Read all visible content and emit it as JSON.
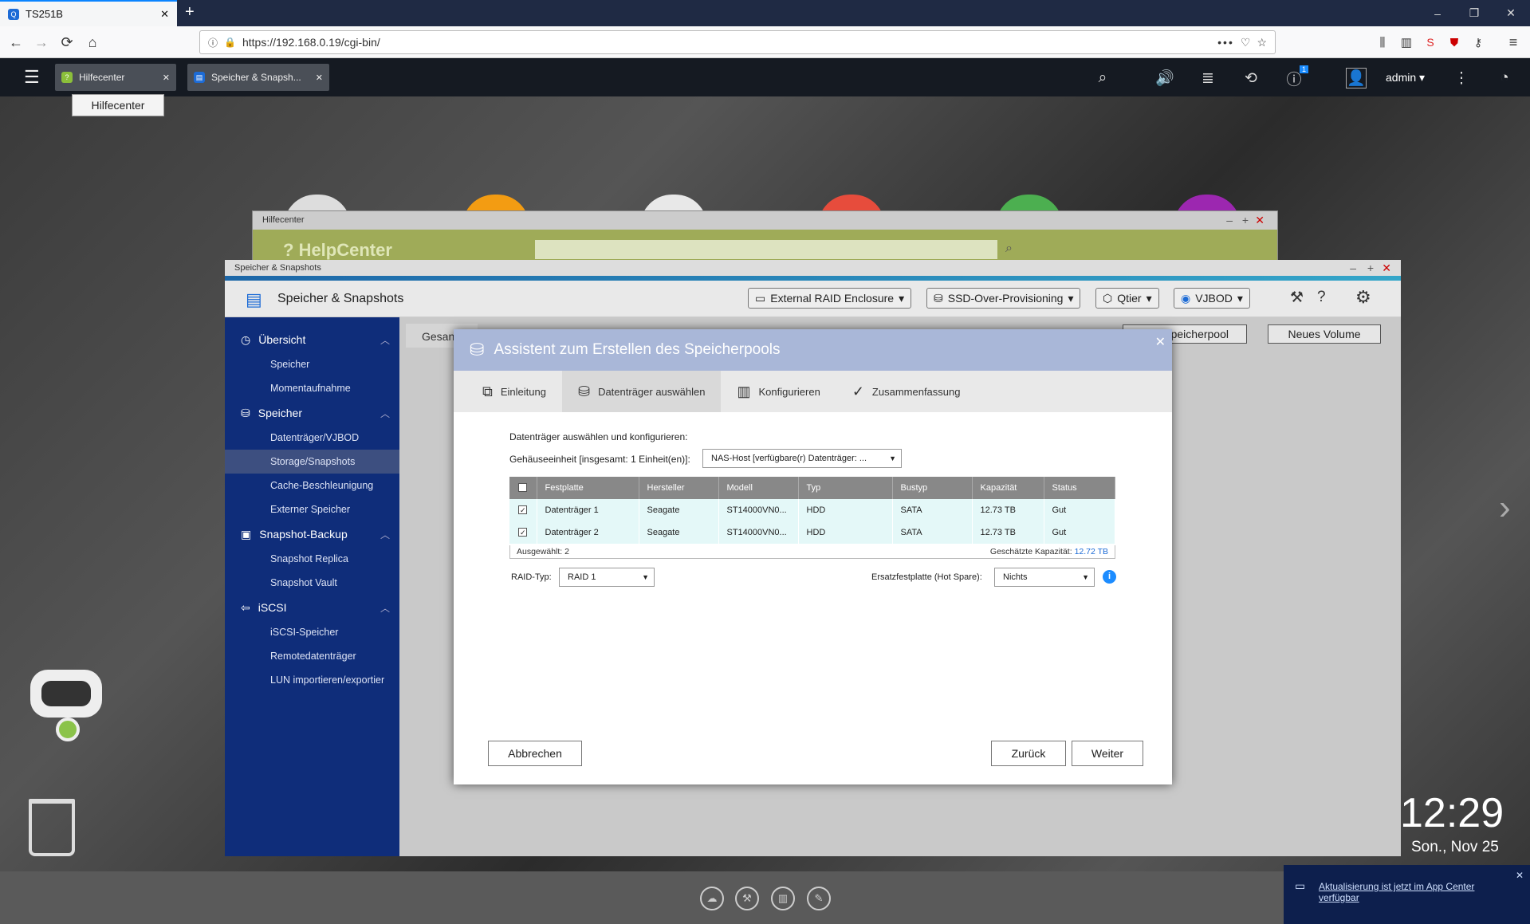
{
  "browser": {
    "tab_title": "TS251B",
    "new_tab": "+",
    "url": "https://192.168.0.19/cgi-bin/",
    "minimize": "–",
    "restore": "❐",
    "close": "✕",
    "back": "←",
    "forward": "→",
    "reload": "⟳",
    "home": "⌂"
  },
  "qts": {
    "tabs": [
      {
        "label": "Hilfecenter"
      },
      {
        "label": "Speicher & Snapsh..."
      }
    ],
    "tooltip": "Hilfecenter",
    "user": "admin",
    "info_badge": "1"
  },
  "help_window": {
    "title": "Hilfecenter",
    "brand": "HelpCenter"
  },
  "storage_window": {
    "title": "Speicher & Snapshots",
    "app_title": "Speicher & Snapshots",
    "header_buttons": [
      "External RAID Enclosure",
      "SSD-Over-Provisioning",
      "Qtier",
      "VJBOD"
    ],
    "partial_tab": "Gesan",
    "top_buttons": [
      "Speicherpool",
      "Neues Volume"
    ],
    "sidebar": {
      "sections": [
        {
          "label": "Übersicht",
          "items": [
            "Speicher",
            "Momentaufnahme"
          ]
        },
        {
          "label": "Speicher",
          "items": [
            "Datenträger/VJBOD",
            "Storage/Snapshots",
            "Cache-Beschleunigung",
            "Externer Speicher"
          ]
        },
        {
          "label": "Snapshot-Backup",
          "items": [
            "Snapshot Replica",
            "Snapshot Vault"
          ]
        },
        {
          "label": "iSCSI",
          "items": [
            "iSCSI-Speicher",
            "Remotedatenträger",
            "LUN importieren/exportier"
          ]
        }
      ]
    }
  },
  "dialog": {
    "title": "Assistent zum Erstellen des Speicherpools",
    "steps": [
      "Einleitung",
      "Datenträger auswählen",
      "Konfigurieren",
      "Zusammenfassung"
    ],
    "heading": "Datenträger auswählen und konfigurieren:",
    "enclosure_label": "Gehäuseeinheit [insgesamt: 1 Einheit(en)]:",
    "enclosure_value": "NAS-Host [verfügbare(r) Datenträger: ...",
    "columns": [
      "Festplatte",
      "Hersteller",
      "Modell",
      "Typ",
      "Bustyp",
      "Kapazität",
      "Status"
    ],
    "rows": [
      {
        "disk": "Datenträger 1",
        "vendor": "Seagate",
        "model": "ST14000VN0...",
        "type": "HDD",
        "bus": "SATA",
        "capacity": "12.73 TB",
        "status": "Gut"
      },
      {
        "disk": "Datenträger 2",
        "vendor": "Seagate",
        "model": "ST14000VN0...",
        "type": "HDD",
        "bus": "SATA",
        "capacity": "12.73 TB",
        "status": "Gut"
      }
    ],
    "selected": "Ausgewählt: 2",
    "est_label": "Geschätzte Kapazität:",
    "est_value": "12.72 TB",
    "raid_label": "RAID-Typ:",
    "raid_value": "RAID 1",
    "spare_label": "Ersatzfestplatte (Hot Spare):",
    "spare_value": "Nichts",
    "cancel": "Abbrechen",
    "back": "Zurück",
    "next": "Weiter"
  },
  "clock": {
    "time": "12:29",
    "date": "Son., Nov 25"
  },
  "notification": {
    "line1": "Aktualisierung ist jetzt im App Center",
    "line2": "verfügbar"
  }
}
